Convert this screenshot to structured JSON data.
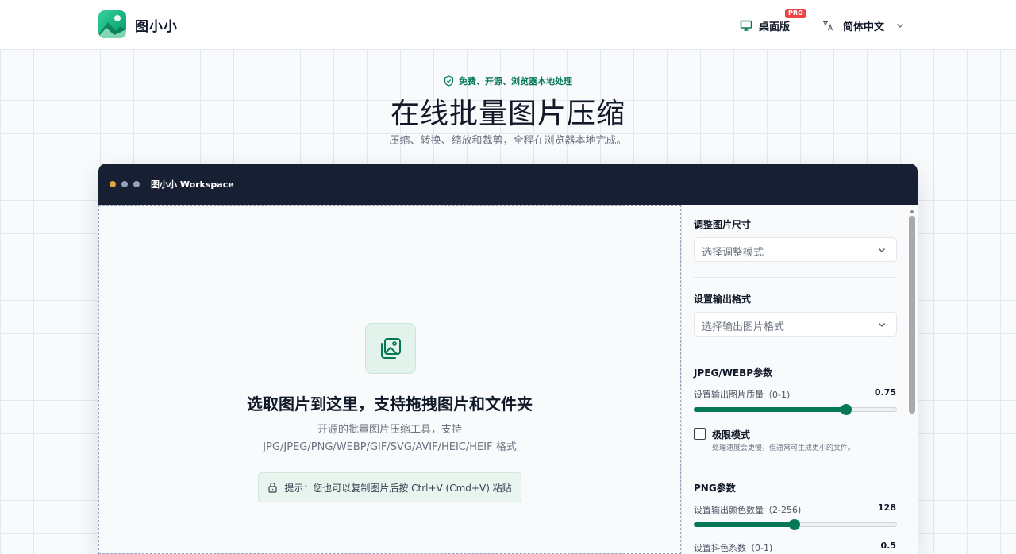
{
  "app": {
    "brand": "图小小",
    "desktop_label": "桌面版",
    "pro_badge": "PRO",
    "language": "简体中文"
  },
  "hero": {
    "badge": "免费、开源、浏览器本地处理",
    "title": "在线批量图片压缩",
    "subtitle": "压缩、转换、缩放和裁剪，全程在浏览器本地完成。"
  },
  "workspace": {
    "title": "图小小 Workspace",
    "dot_colors": [
      "#e0a43b",
      "#94a3b8",
      "#94a3b8"
    ]
  },
  "dropzone": {
    "title": "选取图片到这里，支持拖拽图片和文件夹",
    "desc_line1": "开源的批量图片压缩工具，支持",
    "desc_line2": "JPG/JPEG/PNG/WEBP/GIF/SVG/AVIF/HEIC/HEIF 格式",
    "paste_hint": "提示：您也可以复制图片后按 Ctrl+V (Cmd+V) 粘贴"
  },
  "settings": {
    "resize": {
      "title": "调整图片尺寸",
      "placeholder": "选择调整模式"
    },
    "format": {
      "title": "设置输出格式",
      "placeholder": "选择输出图片格式"
    },
    "jpeg": {
      "title": "JPEG/WEBP参数",
      "quality_label": "设置输出图片质量（0-1)",
      "quality_value": "0.75",
      "quality_fraction": 0.75,
      "extreme_label": "极限模式",
      "extreme_hint": "处理速度会更慢，但通常可生成更小的文件。",
      "extreme_checked": false
    },
    "png": {
      "title": "PNG参数",
      "colors_label": "设置输出颜色数量（2-256)",
      "colors_value": "128",
      "colors_fraction": 0.496,
      "dither_label": "设置抖色系数（0-1)",
      "dither_value": "0.5"
    }
  },
  "colors": {
    "accent": "#047857",
    "header_dark": "#172033"
  }
}
